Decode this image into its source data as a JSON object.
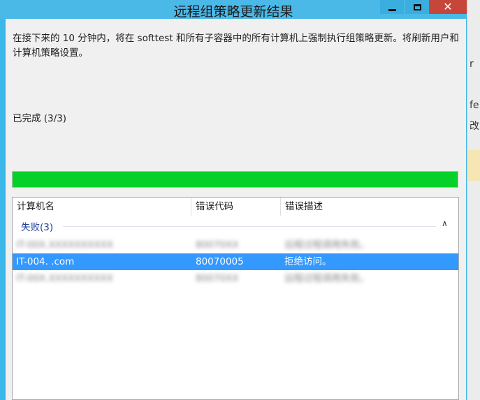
{
  "window": {
    "title": "远程组策略更新结果",
    "buttons": {
      "minimize": "minimize",
      "maximize": "maximize",
      "close": "close"
    },
    "colors": {
      "titlebar": "#4ab9e8",
      "close": "#c7463a"
    }
  },
  "content": {
    "description": "在接下来的 10 分钟内，将在 softtest 和所有子容器中的所有计算机上强制执行组策略更新。将刷新用户和计算机策略设置。",
    "status": "已完成 (3/3)",
    "progress": {
      "value": 1.0,
      "color": "#06d02a"
    }
  },
  "table": {
    "columns": [
      "计算机名",
      "错误代码",
      "错误描述"
    ],
    "group": {
      "label": "失败(3)",
      "chevron": "∧"
    },
    "rows": [
      {
        "computer": "IT-00X.XXXXXXXXXX",
        "code": "80070XX",
        "description": "远程过程调用失败。",
        "selected": false,
        "redacted": true
      },
      {
        "computer": "IT-004.          .com",
        "code": "80070005",
        "description": "拒绝访问。",
        "selected": true,
        "redacted": false
      },
      {
        "computer": "IT-00X.XXXXXXXXXX",
        "code": "80070XX",
        "description": "远程过程调用失败。",
        "selected": false,
        "redacted": true
      }
    ]
  },
  "background_window": {
    "fragments": [
      "r",
      "fe",
      "改"
    ]
  }
}
